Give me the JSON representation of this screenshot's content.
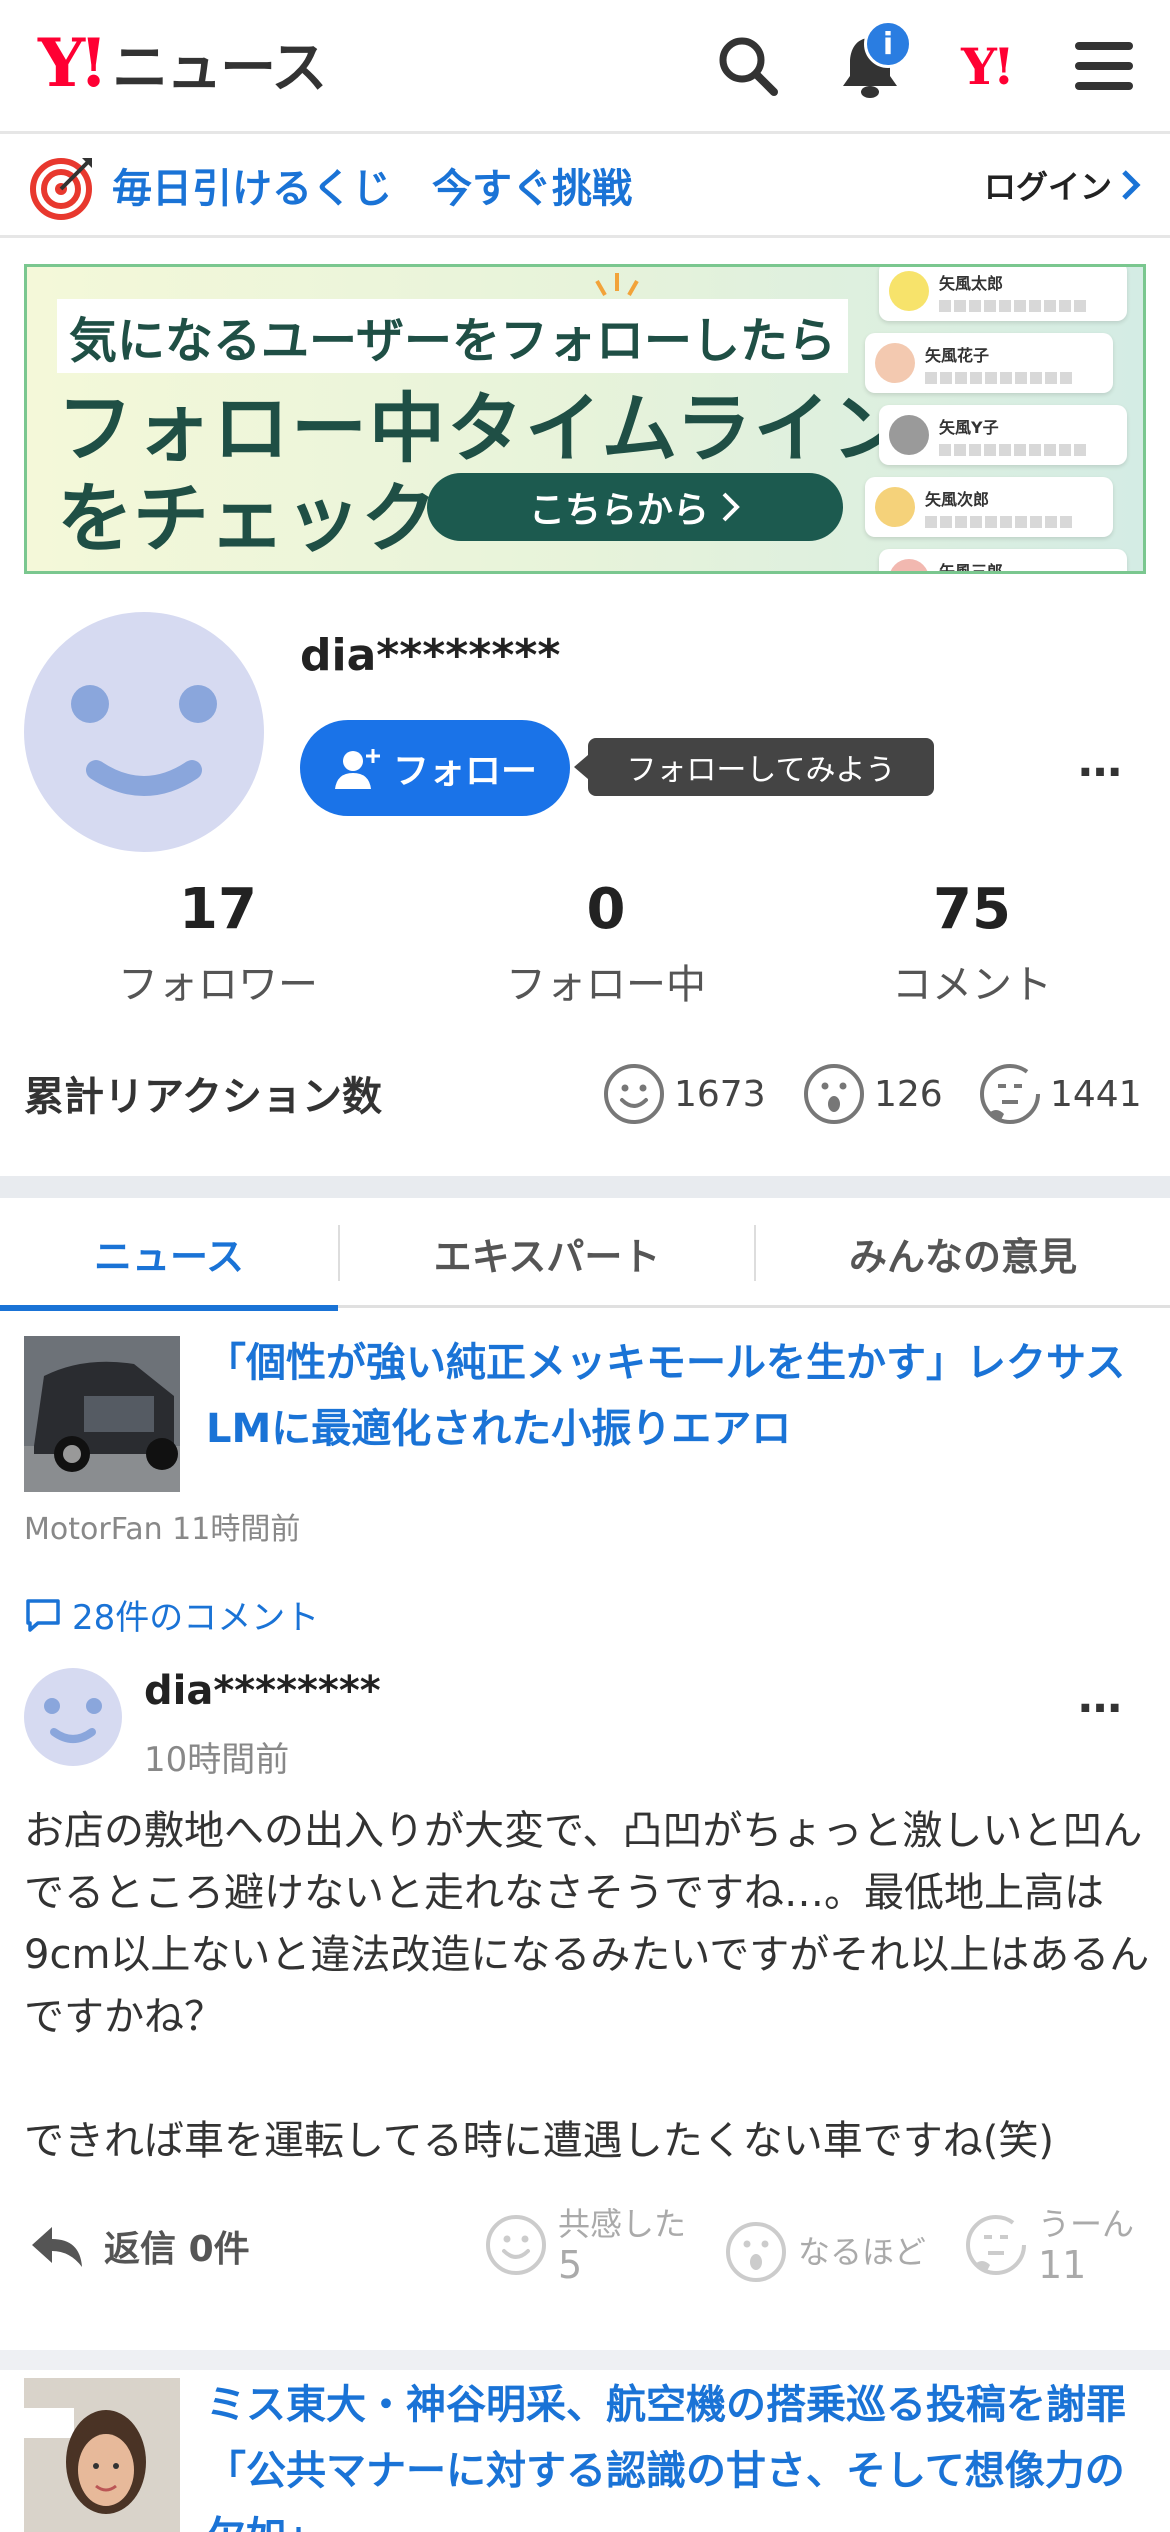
{
  "header": {
    "logo_mark": "Y!",
    "logo_text": "ニュース",
    "notification_badge": "i",
    "yj_mark": "Y!"
  },
  "lottery": {
    "text": "毎日引けるくじ　今すぐ挑戦",
    "login": "ログイン"
  },
  "banner": {
    "line1": "気になるユーザーをフォローしたら",
    "line2": "フォロー中タイムライン",
    "line3": "をチェック",
    "button": "こちらから",
    "cards": [
      {
        "name": "矢風太郎"
      },
      {
        "name": "矢風花子"
      },
      {
        "name": "矢風Y子"
      },
      {
        "name": "矢風次郎"
      },
      {
        "name": "矢風三郎"
      }
    ]
  },
  "profile": {
    "username": "dia********",
    "follow_label": "フォロー",
    "tooltip": "フォローしてみよう",
    "more": "…"
  },
  "stats": [
    {
      "value": "17",
      "label": "フォロワー"
    },
    {
      "value": "0",
      "label": "フォロー中"
    },
    {
      "value": "75",
      "label": "コメント"
    }
  ],
  "reactions": {
    "title": "累計リアクション数",
    "empathy": "1673",
    "naruhodo": "126",
    "uun": "1441"
  },
  "tabs": [
    "ニュース",
    "エキスパート",
    "みんなの意見"
  ],
  "article": {
    "title": "「個性が強い純正メッキモールを生かす」レクサスLMに最適化された小振りエアロ",
    "source": "MotorFan",
    "time": "11時間前",
    "comments_link": "28件のコメント"
  },
  "comment": {
    "user": "dia********",
    "time": "10時間前",
    "body_line1": "お店の敷地への出入りが大変で、凸凹がちょっと激しいと凹んでるところ避けないと走れなさそうですね…。最低地上高は9cm以上ないと違法改造になるみたいですがそれ以上はあるんですかね？",
    "body_line2": "できれば車を運転してる時に遭遇したくない車ですね(笑)",
    "reply_label": "返信",
    "reply_count": "0件",
    "empathy_label": "共感した",
    "empathy_count": "5",
    "naruhodo_label": "なるほど",
    "uun_label": "うーん",
    "uun_count": "11"
  },
  "article2": {
    "title": "ミス東大・神谷明采、航空機の搭乗巡る投稿を謝罪「公共マナーに対する認識の甘さ、そして想像力の欠如」"
  },
  "colors": {
    "accent": "#1a73d6",
    "brand_red": "#ff0033",
    "follow_button": "#1a73e8"
  }
}
